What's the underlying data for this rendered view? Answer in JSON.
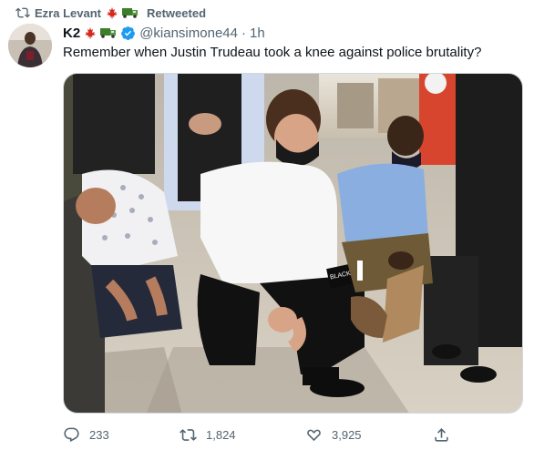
{
  "retweet": {
    "retweeter_name": "Ezra Levant",
    "label": "Retweeted",
    "emoji_icons": [
      "maple-leaf-flag-icon",
      "truck-icon"
    ]
  },
  "author": {
    "display_name": "K2",
    "handle": "@kiansimone44",
    "separator": "·",
    "timestamp": "1h",
    "emoji_icons": [
      "maple-leaf-flag-icon",
      "truck-icon"
    ],
    "verified": true
  },
  "tweet": {
    "text": "Remember when Justin Trudeau took a knee against police brutality?"
  },
  "image": {
    "shirt_text": "BLACK LIVES MATTER"
  },
  "actions": {
    "reply_count": "233",
    "retweet_count": "1,824",
    "like_count": "3,925"
  },
  "colors": {
    "secondary_text": "#536471",
    "verified_blue": "#1d9bf0",
    "maple_red": "#d52b1e",
    "truck_green": "#3e7d2a"
  }
}
